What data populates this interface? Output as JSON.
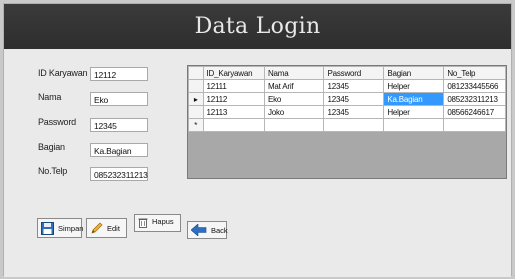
{
  "title": "Data Login",
  "form": {
    "fields": [
      {
        "label": "ID Karyawan",
        "value": "12112"
      },
      {
        "label": "Nama",
        "value": "Eko"
      },
      {
        "label": "Password",
        "value": "12345"
      },
      {
        "label": "Bagian",
        "value": "Ka.Bagian"
      },
      {
        "label": "No.Telp",
        "value": "085232311213"
      }
    ]
  },
  "grid": {
    "columns": [
      "ID_Karyawan",
      "Nama",
      "Password",
      "Bagian",
      "No_Telp"
    ],
    "rows": [
      [
        "12111",
        "Mat Arif",
        "12345",
        "Helper",
        "081233445566"
      ],
      [
        "12112",
        "Eko",
        "12345",
        "Ka.Bagian",
        "085232311213"
      ],
      [
        "12113",
        "Joko",
        "12345",
        "Helper",
        "08566246617"
      ]
    ],
    "current_row_marker": "▸",
    "new_row_marker": "*"
  },
  "buttons": {
    "save": "Simpan",
    "edit": "Edit",
    "delete": "Hapus",
    "back": "Back"
  }
}
